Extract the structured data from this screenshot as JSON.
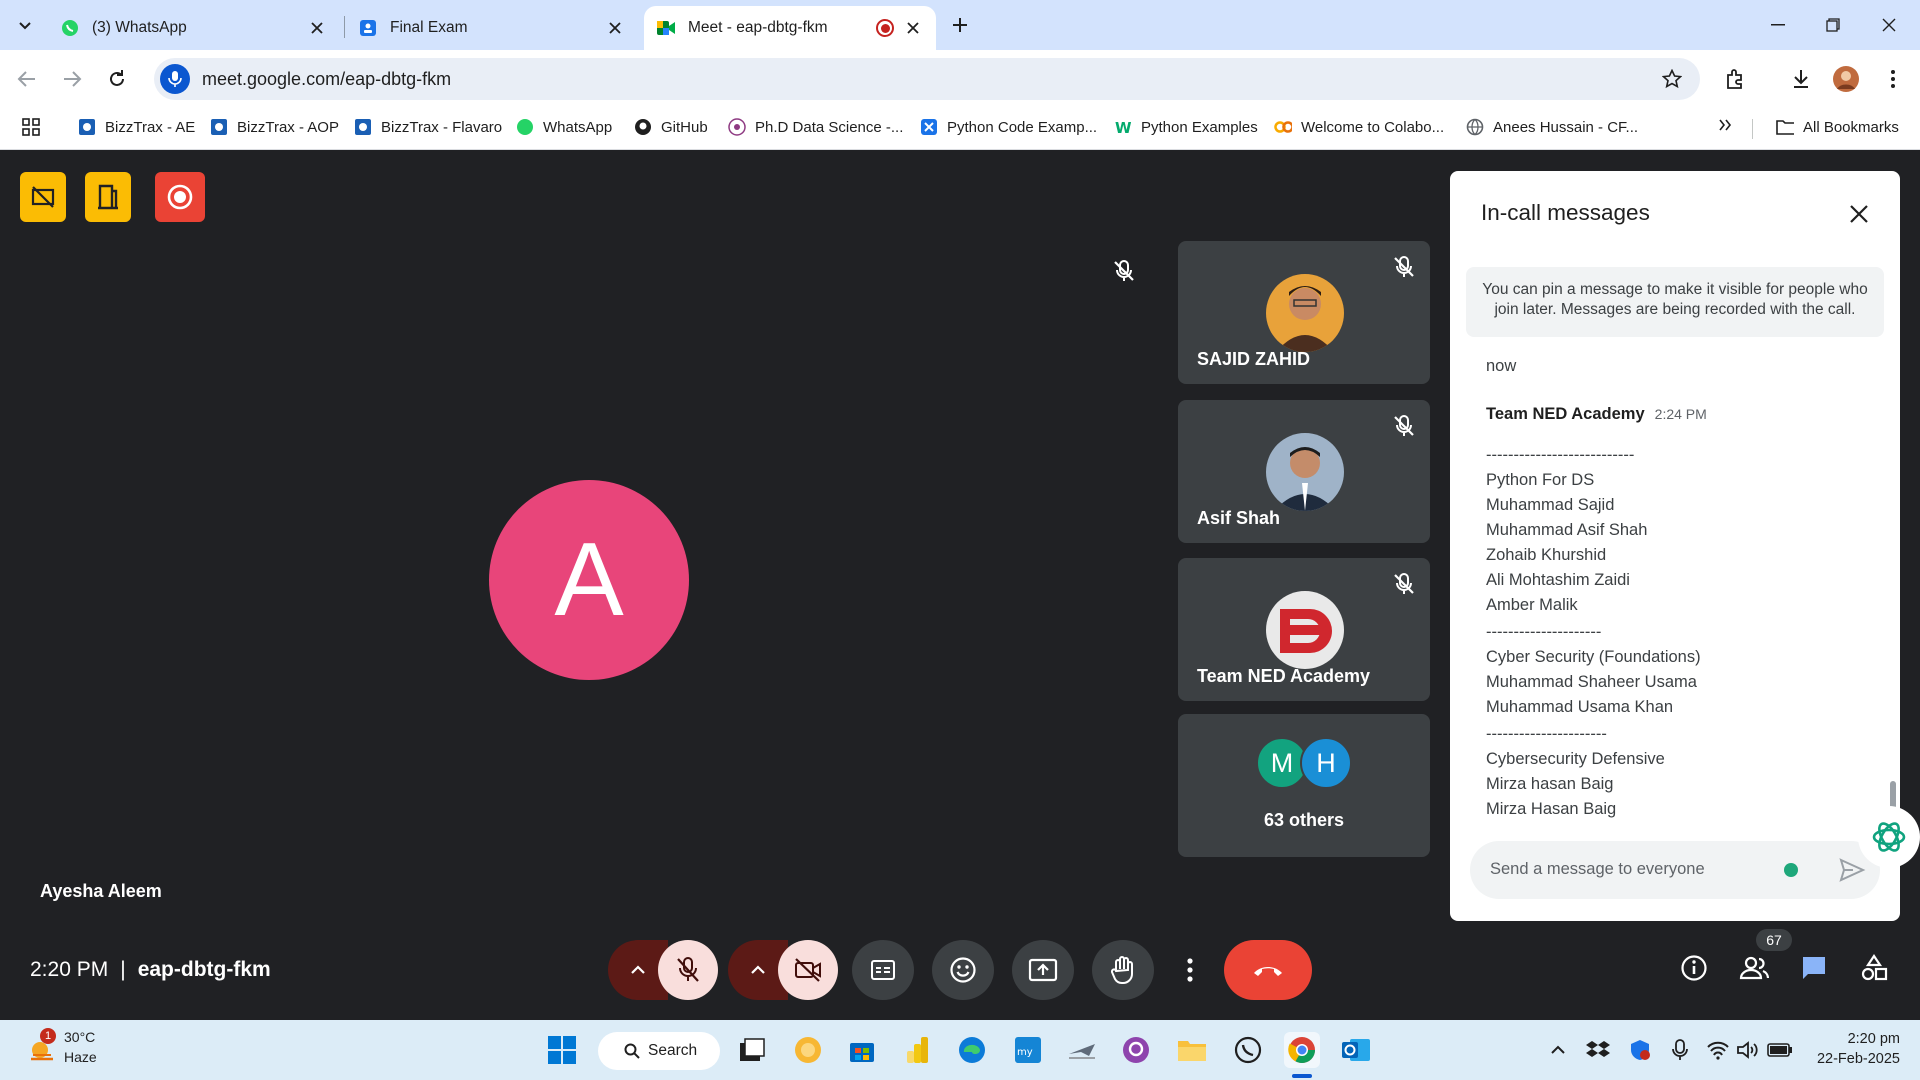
{
  "browser": {
    "tabs": [
      {
        "title": "(3) WhatsApp",
        "icon": "whatsapp-icon"
      },
      {
        "title": "Final Exam",
        "icon": "google-forms-icon"
      },
      {
        "title": "Meet - eap-dbtg-fkm",
        "icon": "google-meet-icon",
        "active": true,
        "recording": true
      }
    ],
    "url": "meet.google.com/eap-dbtg-fkm",
    "bookmarks": [
      {
        "label": "BizzTrax - AE"
      },
      {
        "label": "BizzTrax - AOP"
      },
      {
        "label": "BizzTrax - Flavaro"
      },
      {
        "label": "WhatsApp"
      },
      {
        "label": "GitHub"
      },
      {
        "label": "Ph.D Data Science -..."
      },
      {
        "label": "Python Code Examp..."
      },
      {
        "label": "Python Examples"
      },
      {
        "label": "Welcome to Colabo..."
      },
      {
        "label": "Anees Hussain - CF..."
      }
    ],
    "all_bookmarks": "All Bookmarks"
  },
  "meet": {
    "main_speaker": {
      "initial": "A",
      "name": "Ayesha Aleem",
      "color": "#e8457a"
    },
    "participants": [
      {
        "name": "SAJID ZAHID"
      },
      {
        "name": "Asif Shah"
      },
      {
        "name": "Team NED Academy"
      }
    ],
    "others": {
      "initials": [
        "M",
        "H"
      ],
      "label": "63 others"
    },
    "time": "2:20 PM",
    "meeting_code": "eap-dbtg-fkm",
    "people_count": "67"
  },
  "chat": {
    "title": "In-call messages",
    "pin_note": "You can pin a message to make it visible for people who join later. Messages are being recorded with the call.",
    "now_label": "now",
    "sender": "Team NED Academy",
    "time": "2:24 PM",
    "lines": [
      "---------------------------",
      "Python For DS",
      "Muhammad Sajid",
      "Muhammad Asif Shah",
      "Zohaib Khurshid",
      "Ali Mohtashim Zaidi",
      "Amber Malik",
      "---------------------",
      "Cyber Security (Foundations)",
      "Muhammad Shaheer Usama",
      "Muhammad Usama Khan",
      "----------------------",
      "Cybersecurity Defensive",
      "Mirza hasan Baig",
      "Mirza Hasan Baig"
    ],
    "input_placeholder": "Send a message to everyone"
  },
  "taskbar": {
    "weather_temp": "30°C",
    "weather_desc": "Haze",
    "weather_badge": "1",
    "search_label": "Search",
    "clock_time": "2:20 pm",
    "clock_date": "22-Feb-2025"
  },
  "colors": {
    "accent": "#0b57d0",
    "end_call": "#ea4335",
    "host_yellow": "#fbbc04",
    "record_red": "#ea4335"
  }
}
